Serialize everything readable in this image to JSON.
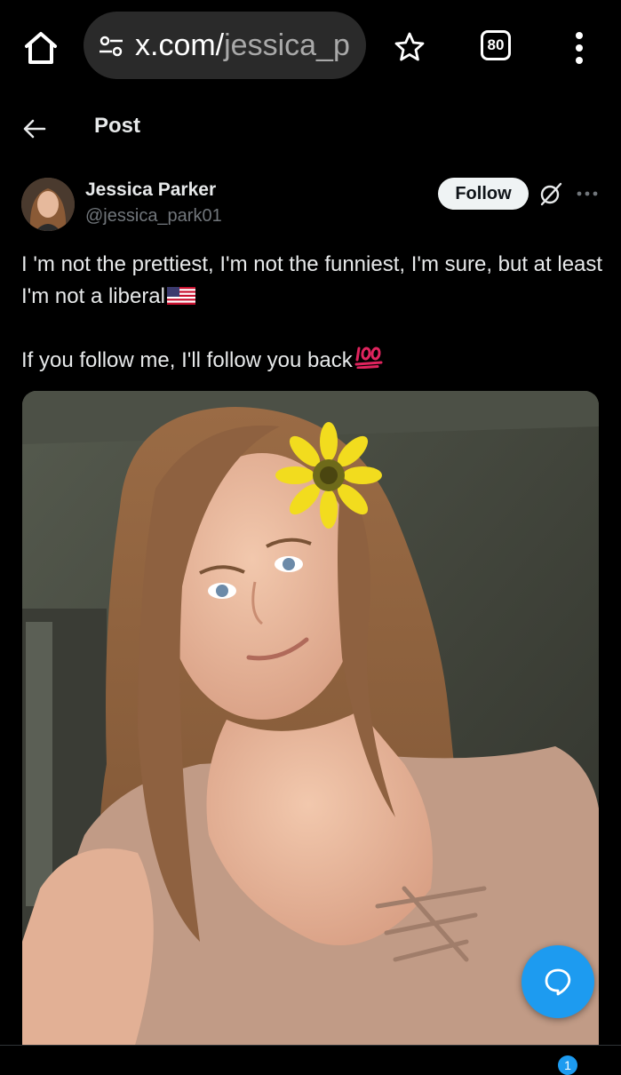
{
  "browser": {
    "url_host": "x.com/",
    "url_path": "jessica_p",
    "tab_count": "80",
    "icons": [
      "home-icon",
      "site-settings-icon",
      "star-icon",
      "tabs-icon",
      "more-vertical-icon"
    ]
  },
  "header": {
    "title": "Post",
    "back_icon": "arrow-left-icon"
  },
  "author": {
    "name": "Jessica Parker",
    "handle": "@jessica_park01",
    "follow_label": "Follow"
  },
  "post": {
    "line1": "I 'm not the prettiest, I'm not the funniest, I'm sure, but at least I'm not a liberal",
    "line1_emoji": "us-flag-emoji",
    "line2": "If you follow me, I'll follow you back",
    "line2_emoji": "hundred-points-emoji"
  },
  "fab": {
    "icon": "compose-reply-icon"
  },
  "bottom": {
    "badge": "1"
  },
  "colors": {
    "background": "#000000",
    "accent": "#1d9bf0",
    "text": "#e7e9ea",
    "muted": "#71767b"
  }
}
